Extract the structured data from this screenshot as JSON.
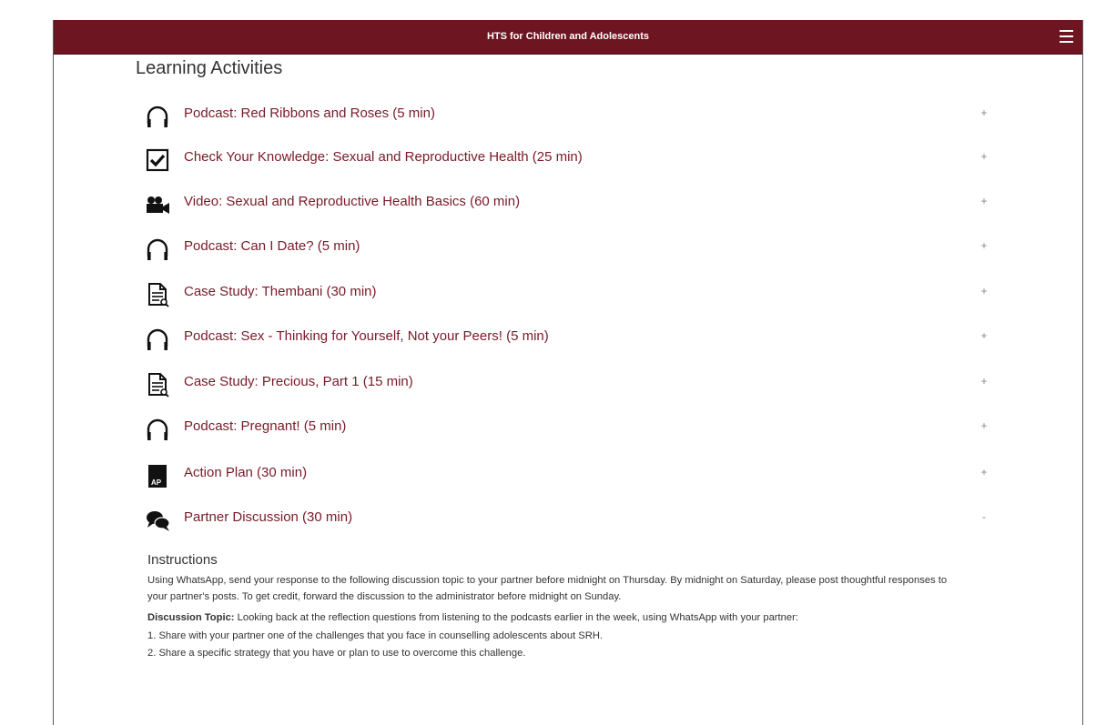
{
  "header": {
    "title": "HTS for Children and Adolescents",
    "menu_icon": "hamburger-menu-icon"
  },
  "page": {
    "heading": "Learning Activities"
  },
  "activities": [
    {
      "icon": "headphones-icon",
      "label": "Podcast: Red Ribbons and Roses (5 min)",
      "toggle": "+"
    },
    {
      "icon": "checkbox-icon",
      "label": "Check Your Knowledge: Sexual and Reproductive Health (25 min)",
      "toggle": "+"
    },
    {
      "icon": "video-camera-icon",
      "label": "Video: Sexual and Reproductive Health Basics (60 min)",
      "toggle": "+"
    },
    {
      "icon": "headphones-icon",
      "label": "Podcast: Can I Date? (5 min)",
      "toggle": "+"
    },
    {
      "icon": "document-icon",
      "label": "Case Study: Thembani (30 min)",
      "toggle": "+"
    },
    {
      "icon": "headphones-icon",
      "label": "Podcast: Sex - Thinking for Yourself, Not your Peers! (5 min)",
      "toggle": "+"
    },
    {
      "icon": "document-icon",
      "label": "Case Study: Precious, Part 1 (15 min)",
      "toggle": "+"
    },
    {
      "icon": "headphones-icon",
      "label": "Podcast: Pregnant! (5 min)",
      "toggle": "+"
    },
    {
      "icon": "action-plan-icon",
      "label": "Action Plan (30 min)",
      "toggle": "+"
    },
    {
      "icon": "chat-bubbles-icon",
      "label": "Partner Discussion (30 min)",
      "toggle": "-"
    }
  ],
  "action_plan_badge": "AP",
  "instructions": {
    "heading": "Instructions",
    "text": "Using WhatsApp, send your response to the following discussion topic to your partner before midnight on Thursday. By midnight on Saturday, please post thoughtful responses to your partner's posts. To get credit, forward the discussion to the administrator before midnight on Sunday.",
    "topic_label": "Discussion Topic:",
    "topic_text": " Looking back at the reflection questions from listening to the podcasts earlier in the week, using WhatsApp with your partner:",
    "steps": [
      "1.  Share with your partner one of the challenges that you face in counselling adolescents about SRH.",
      "2.  Share a specific strategy that you have or plan to use to overcome this challenge."
    ]
  },
  "colors": {
    "header_bg": "#6d1520",
    "link": "#7a1a28",
    "text": "#333333"
  }
}
